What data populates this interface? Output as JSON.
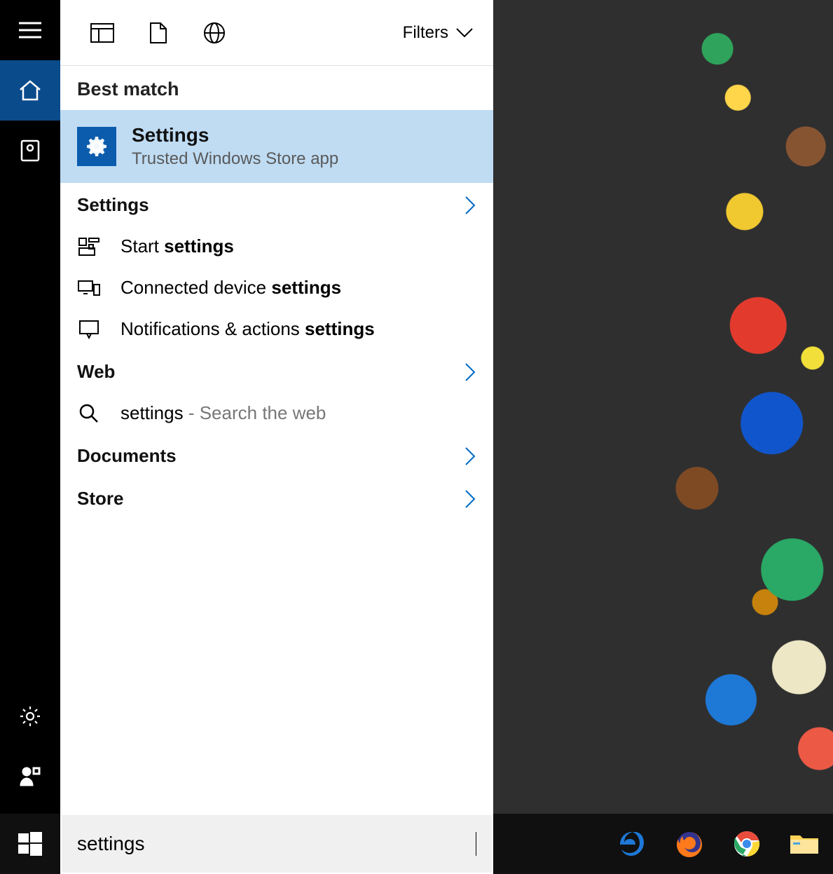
{
  "toolbar": {
    "filters_label": "Filters"
  },
  "sections": {
    "best_match": "Best match",
    "settings": "Settings",
    "web": "Web",
    "documents": "Documents",
    "store": "Store"
  },
  "best_match_result": {
    "title": "Settings",
    "subtitle": "Trusted Windows Store app"
  },
  "settings_results": [
    {
      "prefix": "Start ",
      "bold": "settings"
    },
    {
      "prefix": "Connected device ",
      "bold": "settings"
    },
    {
      "prefix": "Notifications & actions ",
      "bold": "settings"
    }
  ],
  "web_result": {
    "term": "settings",
    "hint": " - Search the web"
  },
  "search": {
    "value": "settings"
  },
  "taskbar": {
    "pinned": [
      "edge",
      "firefox",
      "chrome",
      "file-explorer"
    ]
  }
}
